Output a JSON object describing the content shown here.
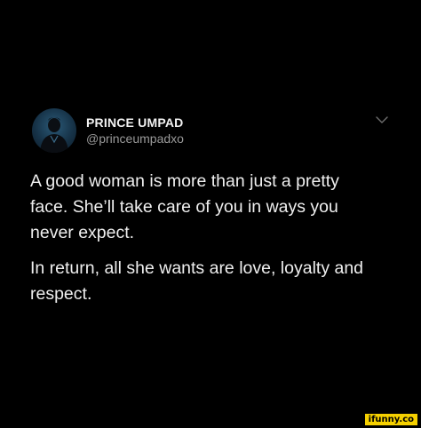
{
  "tweet": {
    "display_name": "PRINCE UMPAD",
    "handle": "@princeumpadxo",
    "paragraphs": [
      "A good woman is more than just a pretty\nface. She’ll take care of you in ways you\nnever expect.",
      "In return, all she wants are love, loyalty and\nrespect."
    ],
    "menu_icon": "chevron-down-icon",
    "avatar_icon": "profile-photo"
  },
  "watermark": {
    "text": "ifunny.co"
  },
  "colors": {
    "background": "#000000",
    "text": "#efefef",
    "handle": "#9a9a9a",
    "watermark_bg": "#f5d000"
  }
}
